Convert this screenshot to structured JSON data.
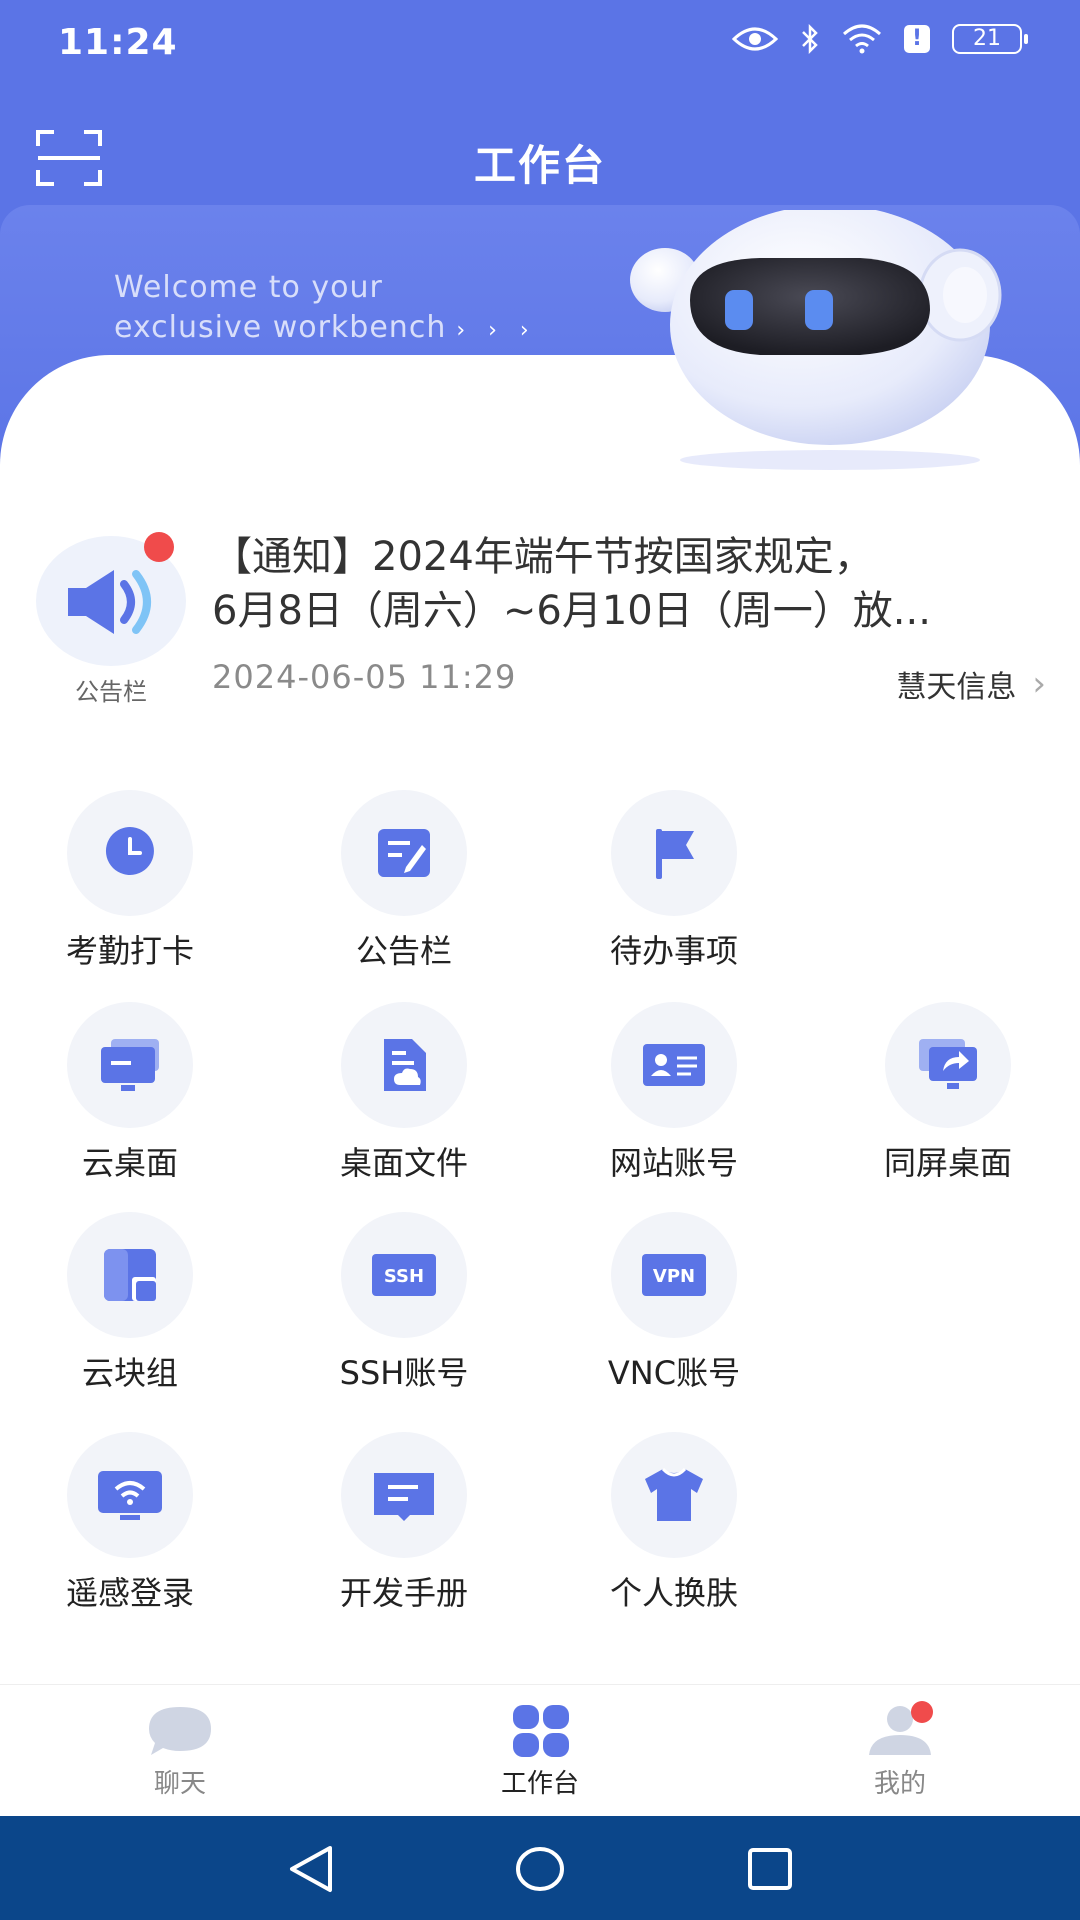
{
  "status_bar": {
    "time": "11:24",
    "battery": "21"
  },
  "header": {
    "title": "工作台",
    "welcome_line1": "Welcome to your",
    "welcome_line2": "exclusive workbench",
    "welcome_arrows": "› › ›"
  },
  "notice": {
    "label": "公告栏",
    "line1": "【通知】2024年端午节按国家规定，",
    "line2": "6月8日（周六）~6月10日（周一）放...",
    "date": "2024-06-05 11:29",
    "source": "慧天信息",
    "chevron": "›"
  },
  "grid": {
    "items": [
      {
        "label": "考勤打卡",
        "icon": "clock-pin-icon"
      },
      {
        "label": "公告栏",
        "icon": "edit-note-icon"
      },
      {
        "label": "待办事项",
        "icon": "flag-icon"
      },
      {
        "label": "云桌面",
        "icon": "cloud-desktop-icon"
      },
      {
        "label": "桌面文件",
        "icon": "file-cloud-icon"
      },
      {
        "label": "网站账号",
        "icon": "id-card-icon"
      },
      {
        "label": "同屏桌面",
        "icon": "screen-share-icon"
      },
      {
        "label": "云块组",
        "icon": "blocks-icon"
      },
      {
        "label": "SSH账号",
        "icon": "ssh-icon"
      },
      {
        "label": "VNC账号",
        "icon": "vpn-icon"
      },
      {
        "label": "遥感登录",
        "icon": "remote-login-icon"
      },
      {
        "label": "开发手册",
        "icon": "book-icon"
      },
      {
        "label": "个人换肤",
        "icon": "shirt-icon"
      }
    ],
    "ssh_text": "SSH",
    "vpn_text": "VPN"
  },
  "tabs": [
    {
      "label": "聊天",
      "icon": "chat-icon"
    },
    {
      "label": "工作台",
      "icon": "workbench-icon"
    },
    {
      "label": "我的",
      "icon": "profile-icon"
    }
  ],
  "colors": {
    "primary": "#5b74e6",
    "accent_red": "#f04b4b",
    "nav_bg": "#0b468a"
  }
}
